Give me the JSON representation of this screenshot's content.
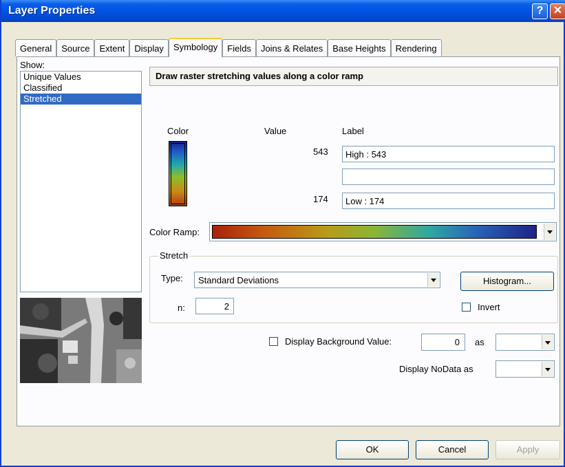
{
  "window": {
    "title": "Layer Properties"
  },
  "tabs": [
    {
      "label": "General"
    },
    {
      "label": "Source"
    },
    {
      "label": "Extent"
    },
    {
      "label": "Display"
    },
    {
      "label": "Symbology",
      "active": true
    },
    {
      "label": "Fields"
    },
    {
      "label": "Joins & Relates"
    },
    {
      "label": "Base Heights"
    },
    {
      "label": "Rendering"
    }
  ],
  "show": {
    "label": "Show:",
    "items": [
      "Unique Values",
      "Classified",
      "Stretched"
    ],
    "selected": "Stretched"
  },
  "main": {
    "heading": "Draw raster stretching values along a color ramp",
    "columns": {
      "color": "Color",
      "value": "Value",
      "label": "Label"
    },
    "high_value": "543",
    "high_label": "High : 543",
    "mid_label": "",
    "low_value": "174",
    "low_label": "Low : 174",
    "color_ramp_label": "Color Ramp:"
  },
  "stretch": {
    "legend": "Stretch",
    "type_label": "Type:",
    "type_value": "Standard Deviations",
    "n_label": "n:",
    "n_value": "2",
    "histogram_button": "Histogram...",
    "invert_label": "Invert",
    "invert_checked": false
  },
  "background": {
    "checkbox_label": "Display Background Value:",
    "checked": false,
    "value": "0",
    "as_label": "as",
    "nodata_label": "Display NoData as"
  },
  "footer": {
    "ok": "OK",
    "cancel": "Cancel",
    "apply": "Apply"
  },
  "colors": {
    "title_bar": "#0054e3",
    "selection": "#316ac5",
    "tab_highlight": "#ffc83c"
  },
  "icons": {
    "help": "help-icon",
    "close": "close-icon"
  }
}
